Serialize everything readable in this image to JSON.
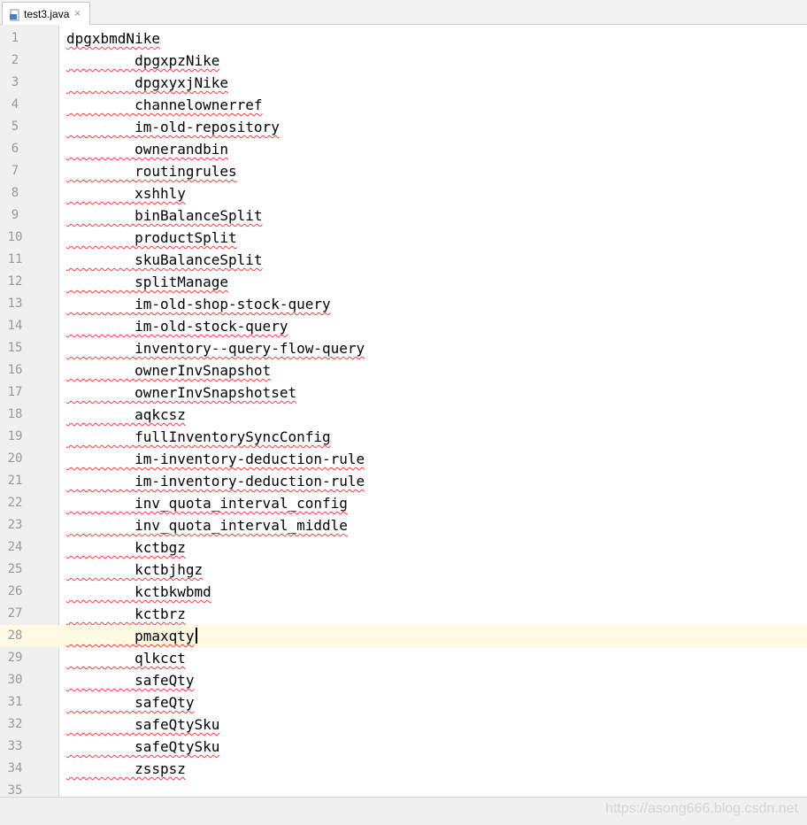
{
  "tab": {
    "label": "test3.java",
    "icon": "java-file-icon",
    "close_glyph": "×"
  },
  "editor": {
    "current_line": 28,
    "lines": [
      {
        "number": "1",
        "text": "dpgxbmdNike"
      },
      {
        "number": "2",
        "text": "        dpgxpzNike"
      },
      {
        "number": "3",
        "text": "        dpgxyxjNike"
      },
      {
        "number": "4",
        "text": "        channelownerref"
      },
      {
        "number": "5",
        "text": "        im-old-repository"
      },
      {
        "number": "6",
        "text": "        ownerandbin"
      },
      {
        "number": "7",
        "text": "        routingrules"
      },
      {
        "number": "8",
        "text": "        xshhly"
      },
      {
        "number": "9",
        "text": "        binBalanceSplit"
      },
      {
        "number": "10",
        "text": "        productSplit"
      },
      {
        "number": "11",
        "text": "        skuBalanceSplit"
      },
      {
        "number": "12",
        "text": "        splitManage"
      },
      {
        "number": "13",
        "text": "        im-old-shop-stock-query"
      },
      {
        "number": "14",
        "text": "        im-old-stock-query"
      },
      {
        "number": "15",
        "text": "        inventory--query-flow-query"
      },
      {
        "number": "16",
        "text": "        ownerInvSnapshot"
      },
      {
        "number": "17",
        "text": "        ownerInvSnapshotset"
      },
      {
        "number": "18",
        "text": "        aqkcsz"
      },
      {
        "number": "19",
        "text": "        fullInventorySyncConfig"
      },
      {
        "number": "20",
        "text": "        im-inventory-deduction-rule"
      },
      {
        "number": "21",
        "text": "        im-inventory-deduction-rule"
      },
      {
        "number": "22",
        "text": "        inv_quota_interval_config"
      },
      {
        "number": "23",
        "text": "        inv_quota_interval_middle"
      },
      {
        "number": "24",
        "text": "        kctbgz"
      },
      {
        "number": "25",
        "text": "        kctbjhgz"
      },
      {
        "number": "26",
        "text": "        kctbkwbmd"
      },
      {
        "number": "27",
        "text": "        kctbrz"
      },
      {
        "number": "28",
        "text": "        pmaxqty"
      },
      {
        "number": "29",
        "text": "        qlkcct"
      },
      {
        "number": "30",
        "text": "        safeQty"
      },
      {
        "number": "31",
        "text": "        safeQty"
      },
      {
        "number": "32",
        "text": "        safeQtySku"
      },
      {
        "number": "33",
        "text": "        safeQtySku"
      },
      {
        "number": "34",
        "text": "        zsspsz"
      },
      {
        "number": "35",
        "text": ""
      }
    ]
  },
  "watermark": "https://asong666.blog.csdn.net",
  "colors": {
    "current_line_highlight": "#fffae3",
    "spellcheck_underline": "#ff3b3b",
    "gutter_background": "#f0f0f0",
    "line_number": "#999999"
  }
}
